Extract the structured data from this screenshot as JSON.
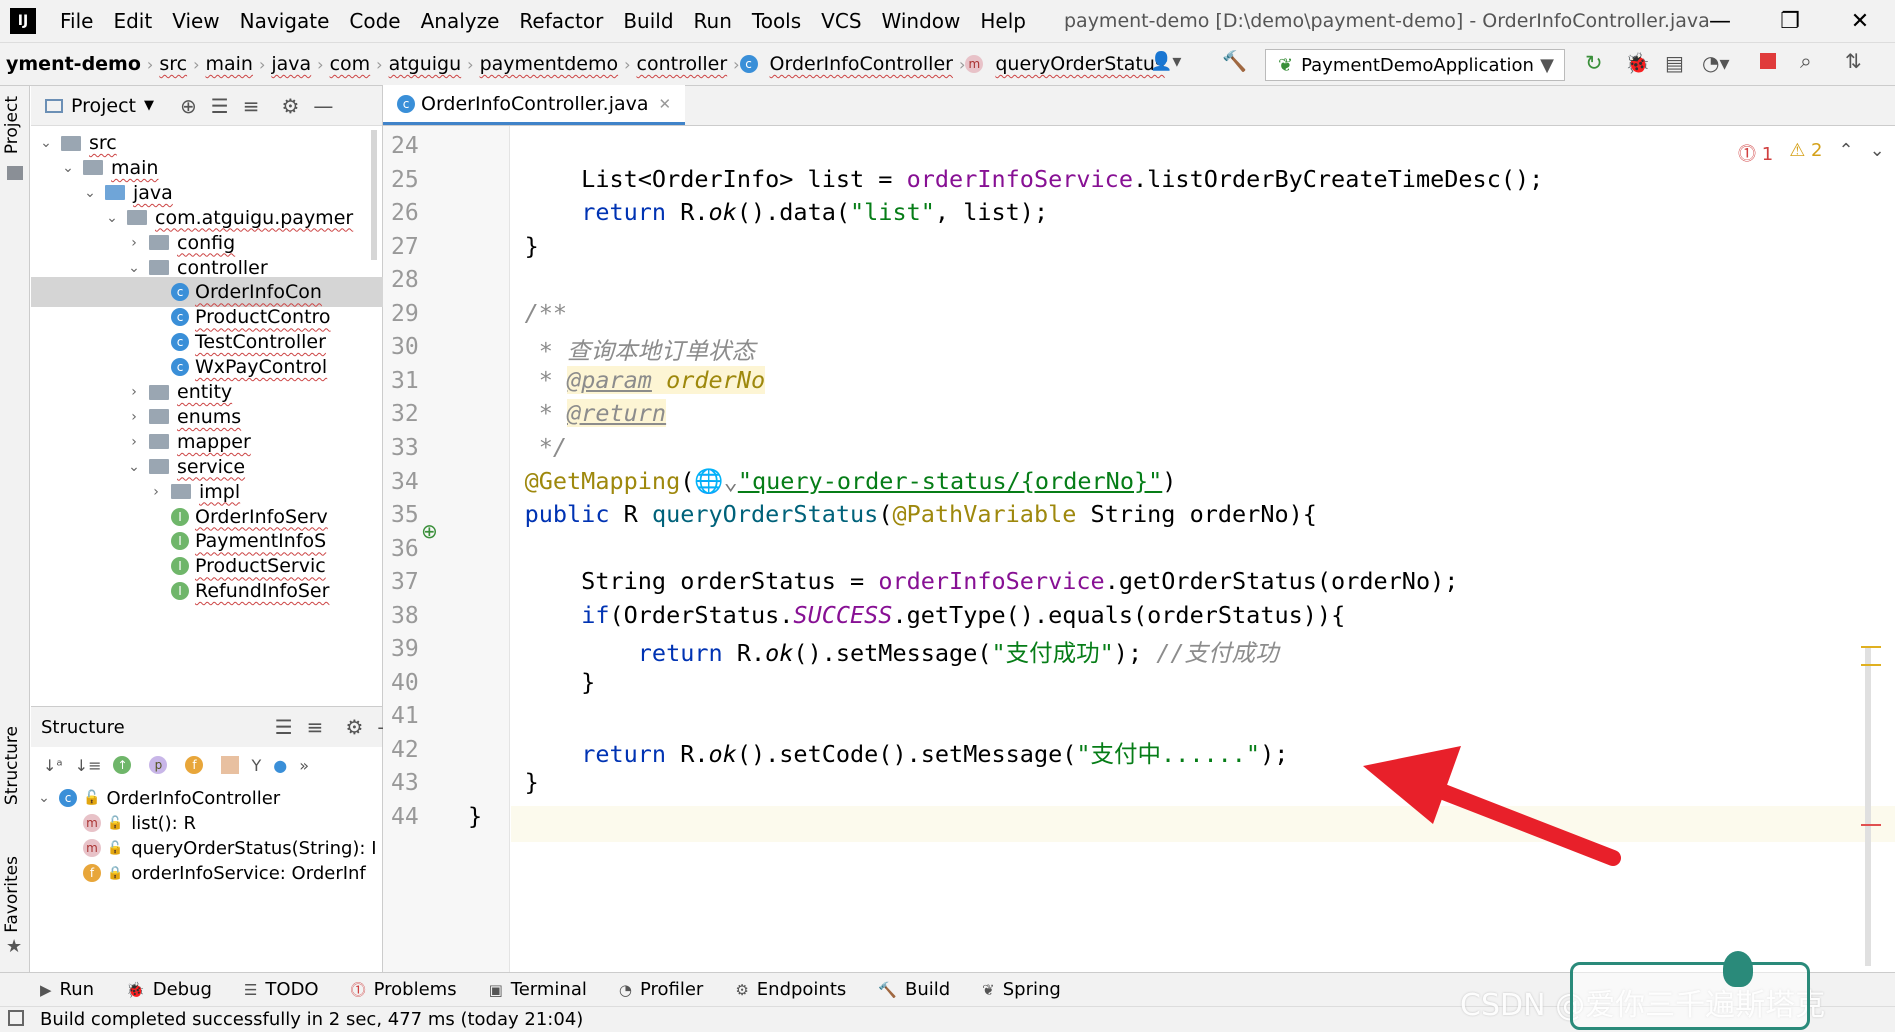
{
  "titlebar": {
    "menus": [
      "File",
      "Edit",
      "View",
      "Navigate",
      "Code",
      "Analyze",
      "Refactor",
      "Build",
      "Run",
      "Tools",
      "VCS",
      "Window",
      "Help"
    ],
    "title": "payment-demo [D:\\demo\\payment-demo] - OrderInfoController.java"
  },
  "breadcrumbs": [
    "yment-demo",
    "src",
    "main",
    "java",
    "com",
    "atguigu",
    "paymentdemo",
    "controller",
    "OrderInfoController",
    "queryOrderStatus"
  ],
  "run_config": "PaymentDemoApplication",
  "project": {
    "header": "Project",
    "tree": [
      {
        "label": "src",
        "depth": 1,
        "arrow": "open",
        "kind": "folder"
      },
      {
        "label": "main",
        "depth": 2,
        "arrow": "open",
        "kind": "folder"
      },
      {
        "label": "java",
        "depth": 3,
        "arrow": "open",
        "kind": "folder-blue"
      },
      {
        "label": "com.atguigu.paymer",
        "depth": 4,
        "arrow": "open",
        "kind": "package"
      },
      {
        "label": "config",
        "depth": 5,
        "arrow": "closed",
        "kind": "package"
      },
      {
        "label": "controller",
        "depth": 5,
        "arrow": "open",
        "kind": "package"
      },
      {
        "label": "OrderInfoCon",
        "depth": 6,
        "arrow": "",
        "kind": "class",
        "selected": true
      },
      {
        "label": "ProductContro",
        "depth": 6,
        "arrow": "",
        "kind": "class"
      },
      {
        "label": "TestController",
        "depth": 6,
        "arrow": "",
        "kind": "class"
      },
      {
        "label": "WxPayControl",
        "depth": 6,
        "arrow": "",
        "kind": "class"
      },
      {
        "label": "entity",
        "depth": 5,
        "arrow": "closed",
        "kind": "package"
      },
      {
        "label": "enums",
        "depth": 5,
        "arrow": "closed",
        "kind": "package"
      },
      {
        "label": "mapper",
        "depth": 5,
        "arrow": "closed",
        "kind": "package"
      },
      {
        "label": "service",
        "depth": 5,
        "arrow": "open",
        "kind": "package"
      },
      {
        "label": "impl",
        "depth": 6,
        "arrow": "closed",
        "kind": "package"
      },
      {
        "label": "OrderInfoServ",
        "depth": 6,
        "arrow": "",
        "kind": "interface"
      },
      {
        "label": "PaymentInfoS",
        "depth": 6,
        "arrow": "",
        "kind": "interface"
      },
      {
        "label": "ProductServic",
        "depth": 6,
        "arrow": "",
        "kind": "interface"
      },
      {
        "label": "RefundInfoSer",
        "depth": 6,
        "arrow": "",
        "kind": "interface"
      }
    ]
  },
  "structure": {
    "header": "Structure",
    "root": "OrderInfoController",
    "members": [
      {
        "badge": "m",
        "label": "list(): R"
      },
      {
        "badge": "m",
        "label": "queryOrderStatus(String): I"
      },
      {
        "badge": "f",
        "label": "orderInfoService: OrderInf"
      }
    ]
  },
  "side_tabs": {
    "project": "Project",
    "structure": "Structure",
    "favorites": "Favorites"
  },
  "editor": {
    "tab": "OrderInfoController.java",
    "inspections": {
      "errors": "1",
      "warnings": "2"
    },
    "line_numbers": [
      "24",
      "25",
      "26",
      "27",
      "28",
      "29",
      "30",
      "31",
      "32",
      "33",
      "34",
      "35",
      "36",
      "37",
      "38",
      "39",
      "40",
      "41",
      "42",
      "43",
      "44"
    ]
  },
  "bottom_tools": [
    "Run",
    "Debug",
    "TODO",
    "Problems",
    "Terminal",
    "Profiler",
    "Endpoints",
    "Build",
    "Spring"
  ],
  "status": "Build completed successfully in 2 sec, 477 ms (today 21:04)",
  "watermark": "CSDN @爱你三千遍斯塔克",
  "colors": {
    "keyword": "#0033b3",
    "field": "#871094",
    "string": "#067d17",
    "comment": "#8c8c8c",
    "annotation": "#9e880d",
    "arrow": "#e8202a"
  }
}
